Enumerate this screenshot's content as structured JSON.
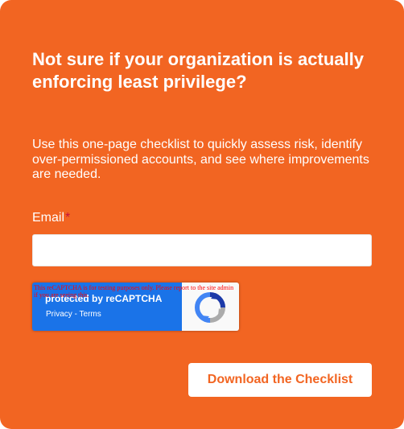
{
  "form": {
    "headline": "Not sure if your organization is actually enforcing least privilege?",
    "description": "Use this one-page checklist to quickly assess risk, identify over-permissioned accounts, and see where improvements are needed.",
    "email_label": "Email",
    "required_marker": "*",
    "email_value": "",
    "email_placeholder": "",
    "submit_label": "Download the Checklist"
  },
  "recaptcha": {
    "warning": "This reCAPTCHA is for testing purposes only. Please report to the site admin if you are seeing this.",
    "protected_text": "protected by reCAPTCHA",
    "privacy_label": "Privacy",
    "separator": " - ",
    "terms_label": "Terms",
    "logo_icon": "recaptcha-logo-icon"
  },
  "colors": {
    "card_background": "#f26522",
    "button_text": "#f26522",
    "required_marker": "#c4123f",
    "recaptcha_blue": "#1a73e8"
  }
}
